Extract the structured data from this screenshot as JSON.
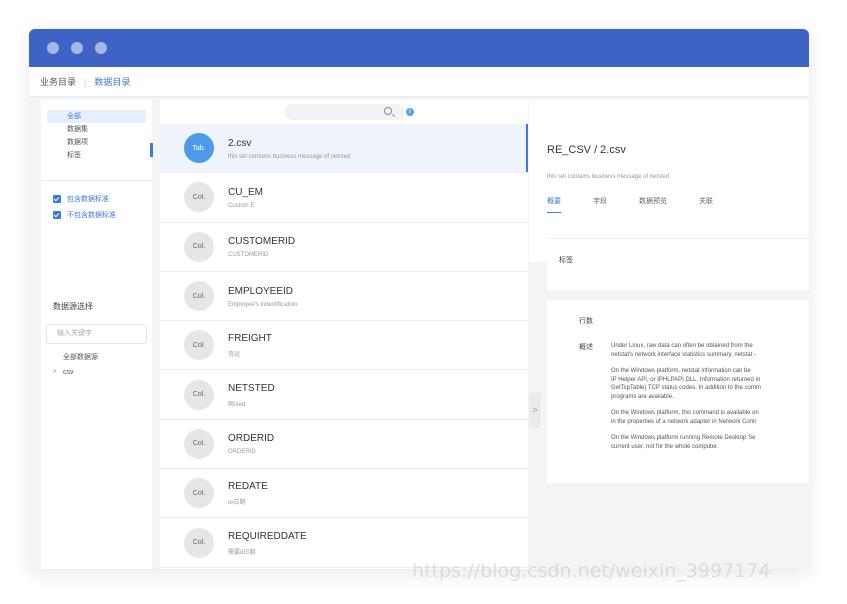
{
  "window": {
    "dots": 3
  },
  "nav": {
    "crumb1": "业务目录",
    "crumb2": "数据目录"
  },
  "left": {
    "tree": [
      "全部",
      "数据集",
      "数据项",
      "标签"
    ],
    "checks": [
      "包含数据标准",
      "不包含数据标准"
    ],
    "source_title": "数据源选择",
    "keyword_placeholder": "输入关键字",
    "sources": [
      "全部数据源",
      "csv"
    ]
  },
  "middle": {
    "rows": [
      {
        "avatar": "Tab.",
        "name": "2.csv",
        "desc": "this set contains business message of netsted",
        "selected": true
      },
      {
        "avatar": "Col.",
        "name": "CU_EM",
        "desc": "Custom E"
      },
      {
        "avatar": "Col.",
        "name": "CUSTOMERID",
        "desc": "CUSTOMERID"
      },
      {
        "avatar": "Col.",
        "name": "EMPLOYEEID",
        "desc": "Employee's indentification"
      },
      {
        "avatar": "Col.",
        "name": "FREIGHT",
        "desc": "货运"
      },
      {
        "avatar": "Col.",
        "name": "NETSTED",
        "desc": "网sted"
      },
      {
        "avatar": "Col.",
        "name": "ORDERID",
        "desc": "ORDERID"
      },
      {
        "avatar": "Col.",
        "name": "REDATE",
        "desc": "re日期"
      },
      {
        "avatar": "Col.",
        "name": "REQUIREDDATE",
        "desc": "需要d日期"
      }
    ]
  },
  "detail": {
    "title": "RE_CSV / 2.csv",
    "subtitle": "this set contains business message of netsted",
    "tabs": [
      "概要",
      "字段",
      "数据预览",
      "关联"
    ],
    "tag_label": "标签",
    "rows_label": "行数",
    "overview_label": "概述",
    "paragraphs": [
      [
        "Under Linux, raw data can often be obtained from the",
        "netstat's network interface statistics summary, netstat -"
      ],
      [
        "On the Windows platform, netstat information can be",
        "IP Helper API, or IPHLPAPI.DLL. Information returned in",
        "GetTcpTable) TCP status codes. In addition to the comm",
        "programs are available."
      ],
      [
        "On the Windows platform, this command is available on",
        "in the properties of a network adapter in Network Conn"
      ],
      [
        "On the Windows platform running Remote Desktop Se",
        "current user, not for the whole computer."
      ]
    ]
  },
  "watermark": "https://blog.csdn.net/weixin_3997174"
}
